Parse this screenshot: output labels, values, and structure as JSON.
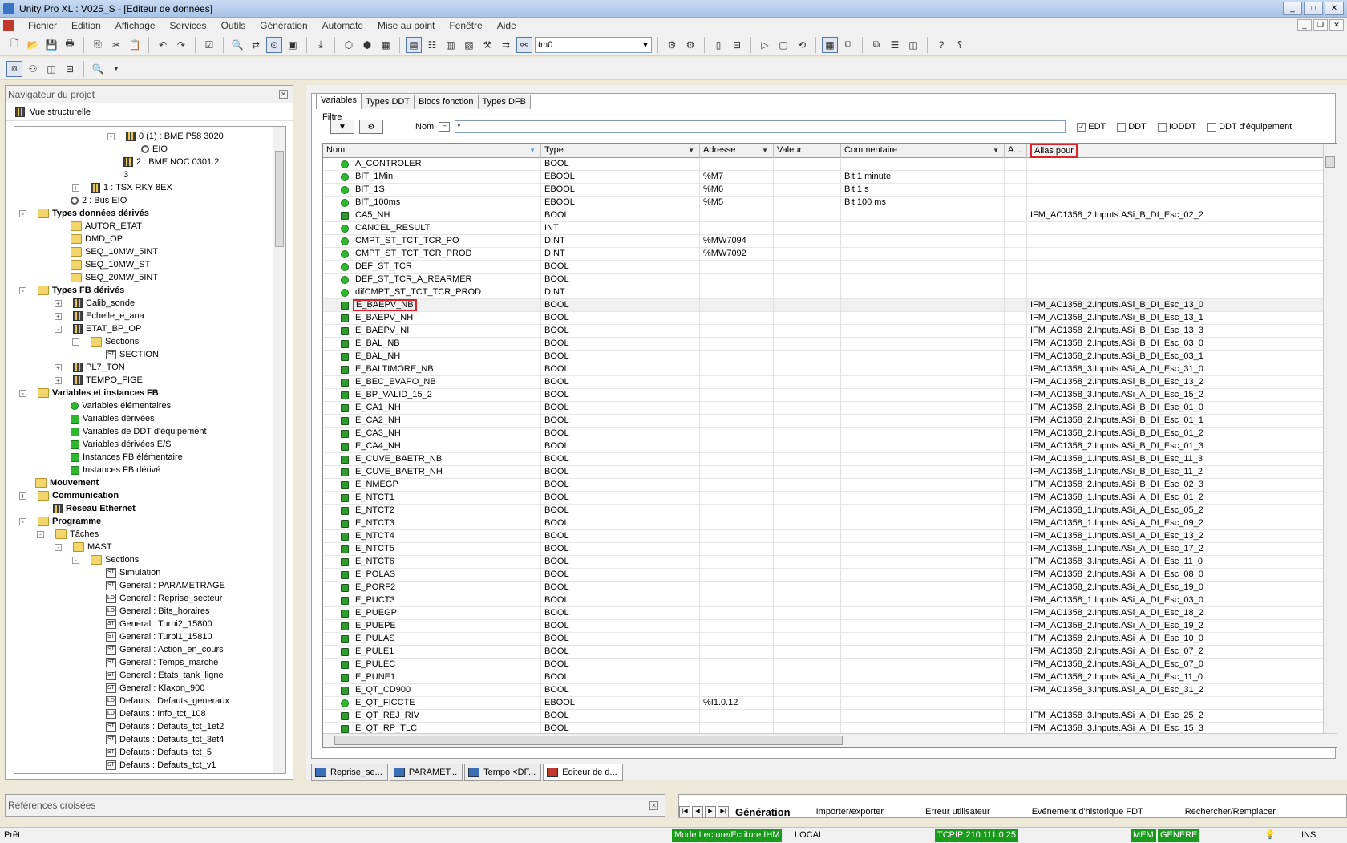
{
  "window": {
    "title": "Unity Pro XL : V025_S - [Editeur de données]"
  },
  "menu": [
    "Fichier",
    "Edition",
    "Affichage",
    "Services",
    "Outils",
    "Génération",
    "Automate",
    "Mise au point",
    "Fenêtre",
    "Aide"
  ],
  "toolbar": {
    "combo_value": "tm0"
  },
  "left_panel": {
    "title": "Navigateur du projet",
    "view_label": "Vue structurelle",
    "tree": [
      {
        "label": "0 (1) : BME P58 3020",
        "indent": 6,
        "icon": "module",
        "exp": "-"
      },
      {
        "label": "EIO",
        "indent": 7,
        "icon": "gear"
      },
      {
        "label": "2 : BME NOC 0301.2",
        "indent": 6,
        "icon": "module"
      },
      {
        "label": "3",
        "indent": 6,
        "icon": "none"
      },
      {
        "label": "1 : TSX RKY 8EX",
        "indent": 4,
        "icon": "module",
        "exp": "+"
      },
      {
        "label": "2 : Bus EIO",
        "indent": 3,
        "icon": "gear"
      },
      {
        "label": "Types données dérivés",
        "indent": 1,
        "icon": "folder",
        "bold": true,
        "exp": "-"
      },
      {
        "label": "AUTOR_ETAT",
        "indent": 3,
        "icon": "folder"
      },
      {
        "label": "DMD_OP",
        "indent": 3,
        "icon": "folder"
      },
      {
        "label": "SEQ_10MW_5INT",
        "indent": 3,
        "icon": "folder"
      },
      {
        "label": "SEQ_10MW_ST",
        "indent": 3,
        "icon": "folder"
      },
      {
        "label": "SEQ_20MW_5INT",
        "indent": 3,
        "icon": "folder"
      },
      {
        "label": "Types FB dérivés",
        "indent": 1,
        "icon": "folder",
        "bold": true,
        "exp": "-"
      },
      {
        "label": "Calib_sonde",
        "indent": 3,
        "icon": "module",
        "exp": "+"
      },
      {
        "label": "Echelle_e_ana",
        "indent": 3,
        "icon": "module",
        "exp": "+"
      },
      {
        "label": "ETAT_BP_OP",
        "indent": 3,
        "icon": "module",
        "exp": "-"
      },
      {
        "label": "Sections",
        "indent": 4,
        "icon": "folder",
        "exp": "-"
      },
      {
        "label": "SECTION",
        "indent": 5,
        "icon": "st"
      },
      {
        "label": "PL7_TON",
        "indent": 3,
        "icon": "module",
        "exp": "+"
      },
      {
        "label": "TEMPO_FIGE",
        "indent": 3,
        "icon": "module",
        "exp": "+"
      },
      {
        "label": "Variables et instances FB",
        "indent": 1,
        "icon": "folder",
        "bold": true,
        "exp": "-"
      },
      {
        "label": "Variables élémentaires",
        "indent": 3,
        "icon": "green"
      },
      {
        "label": "Variables dérivées",
        "indent": 3,
        "icon": "greensq"
      },
      {
        "label": "Variables de DDT d'équipement",
        "indent": 3,
        "icon": "greensq"
      },
      {
        "label": "Variables dérivées E/S",
        "indent": 3,
        "icon": "greensq"
      },
      {
        "label": "Instances FB élémentaire",
        "indent": 3,
        "icon": "greensq"
      },
      {
        "label": "Instances FB dérivé",
        "indent": 3,
        "icon": "greensq"
      },
      {
        "label": "Mouvement",
        "indent": 1,
        "icon": "folder",
        "bold": true
      },
      {
        "label": "Communication",
        "indent": 1,
        "icon": "folder",
        "bold": true,
        "exp": "+"
      },
      {
        "label": "Réseau Ethernet",
        "indent": 2,
        "icon": "module",
        "bold": true
      },
      {
        "label": "Programme",
        "indent": 1,
        "icon": "folder",
        "bold": true,
        "exp": "-"
      },
      {
        "label": "Tâches",
        "indent": 2,
        "icon": "folder",
        "exp": "-"
      },
      {
        "label": "MAST",
        "indent": 3,
        "icon": "folder",
        "exp": "-"
      },
      {
        "label": "Sections",
        "indent": 4,
        "icon": "folder",
        "exp": "-"
      },
      {
        "label": "Simulation",
        "indent": 5,
        "icon": "st"
      },
      {
        "label": "General : PARAMETRAGE",
        "indent": 5,
        "icon": "st"
      },
      {
        "label": "General : Reprise_secteur",
        "indent": 5,
        "icon": "ld"
      },
      {
        "label": "General : Bits_horaires",
        "indent": 5,
        "icon": "ld"
      },
      {
        "label": "General : Turbi2_15800",
        "indent": 5,
        "icon": "st"
      },
      {
        "label": "General : Turbi1_15810",
        "indent": 5,
        "icon": "st"
      },
      {
        "label": "General : Action_en_cours",
        "indent": 5,
        "icon": "st"
      },
      {
        "label": "General : Temps_marche",
        "indent": 5,
        "icon": "st"
      },
      {
        "label": "General : Etats_tank_ligne",
        "indent": 5,
        "icon": "st"
      },
      {
        "label": "General : Klaxon_900",
        "indent": 5,
        "icon": "st"
      },
      {
        "label": "Defauts : Defauts_generaux",
        "indent": 5,
        "icon": "ld"
      },
      {
        "label": "Defauts : Info_tct_108",
        "indent": 5,
        "icon": "ld"
      },
      {
        "label": "Defauts : Defauts_tct_1et2",
        "indent": 5,
        "icon": "st"
      },
      {
        "label": "Defauts : Defauts_tct_3et4",
        "indent": 5,
        "icon": "st"
      },
      {
        "label": "Defauts : Defauts_tct_5",
        "indent": 5,
        "icon": "st"
      },
      {
        "label": "Defauts : Defauts_tct_v1",
        "indent": 5,
        "icon": "st"
      }
    ]
  },
  "editor": {
    "tabs": [
      "Variables",
      "Types DDT",
      "Blocs fonction",
      "Types DFB"
    ],
    "filter_label": "Filtre",
    "name_label": "Nom",
    "eq_label": "=",
    "filter_value": "*",
    "checkboxes": [
      {
        "label": "EDT",
        "checked": true
      },
      {
        "label": "DDT",
        "checked": false
      },
      {
        "label": "IODDT",
        "checked": false
      },
      {
        "label": "DDT d'équipement",
        "checked": false
      }
    ],
    "columns": {
      "nom": "Nom",
      "type": "Type",
      "adresse": "Adresse",
      "valeur": "Valeur",
      "commentaire": "Commentaire",
      "a": "A...",
      "alias": "Alias pour"
    },
    "rows": [
      {
        "icon": "green",
        "name": "A_CONTROLER",
        "type": "BOOL",
        "addr": "",
        "val": "",
        "comment": "",
        "alias": ""
      },
      {
        "icon": "green",
        "name": "BIT_1Min",
        "type": "EBOOL",
        "addr": "%M7",
        "val": "",
        "comment": "Bit  1 minute",
        "alias": ""
      },
      {
        "icon": "green",
        "name": "BIT_1S",
        "type": "EBOOL",
        "addr": "%M6",
        "val": "",
        "comment": "Bit  1 s",
        "alias": ""
      },
      {
        "icon": "green",
        "name": "BIT_100ms",
        "type": "EBOOL",
        "addr": "%M5",
        "val": "",
        "comment": "Bit  100 ms",
        "alias": ""
      },
      {
        "icon": "alias",
        "name": "CA5_NH",
        "type": "BOOL",
        "addr": "",
        "val": "",
        "comment": "",
        "alias": "IFM_AC1358_2.Inputs.ASi_B_DI_Esc_02_2"
      },
      {
        "icon": "green",
        "name": "CANCEL_RESULT",
        "type": "INT",
        "addr": "",
        "val": "",
        "comment": "",
        "alias": ""
      },
      {
        "icon": "green",
        "name": "CMPT_ST_TCT_TCR_PO",
        "type": "DINT",
        "addr": "%MW7094",
        "val": "",
        "comment": "",
        "alias": ""
      },
      {
        "icon": "green",
        "name": "CMPT_ST_TCT_TCR_PROD",
        "type": "DINT",
        "addr": "%MW7092",
        "val": "",
        "comment": "",
        "alias": ""
      },
      {
        "icon": "green",
        "name": "DEF_ST_TCR",
        "type": "BOOL",
        "addr": "",
        "val": "",
        "comment": "",
        "alias": ""
      },
      {
        "icon": "green",
        "name": "DEF_ST_TCR_A_REARMER",
        "type": "BOOL",
        "addr": "",
        "val": "",
        "comment": "",
        "alias": ""
      },
      {
        "icon": "green",
        "name": "difCMPT_ST_TCT_TCR_PROD",
        "type": "DINT",
        "addr": "",
        "val": "",
        "comment": "",
        "alias": ""
      },
      {
        "icon": "alias",
        "name": "E_BAEPV_NB",
        "type": "BOOL",
        "addr": "",
        "val": "",
        "comment": "",
        "alias": "IFM_AC1358_2.Inputs.ASi_B_DI_Esc_13_0",
        "highlight": true
      },
      {
        "icon": "alias",
        "name": "E_BAEPV_NH",
        "type": "BOOL",
        "addr": "",
        "val": "",
        "comment": "",
        "alias": "IFM_AC1358_2.Inputs.ASi_B_DI_Esc_13_1"
      },
      {
        "icon": "alias",
        "name": "E_BAEPV_NI",
        "type": "BOOL",
        "addr": "",
        "val": "",
        "comment": "",
        "alias": "IFM_AC1358_2.Inputs.ASi_B_DI_Esc_13_3"
      },
      {
        "icon": "alias",
        "name": "E_BAL_NB",
        "type": "BOOL",
        "addr": "",
        "val": "",
        "comment": "",
        "alias": "IFM_AC1358_2.Inputs.ASi_B_DI_Esc_03_0"
      },
      {
        "icon": "alias",
        "name": "E_BAL_NH",
        "type": "BOOL",
        "addr": "",
        "val": "",
        "comment": "",
        "alias": "IFM_AC1358_2.Inputs.ASi_B_DI_Esc_03_1"
      },
      {
        "icon": "alias",
        "name": "E_BALTIMORE_NB",
        "type": "BOOL",
        "addr": "",
        "val": "",
        "comment": "",
        "alias": "IFM_AC1358_3.Inputs.ASi_A_DI_Esc_31_0"
      },
      {
        "icon": "alias",
        "name": "E_BEC_EVAPO_NB",
        "type": "BOOL",
        "addr": "",
        "val": "",
        "comment": "",
        "alias": "IFM_AC1358_2.Inputs.ASi_B_DI_Esc_13_2"
      },
      {
        "icon": "alias",
        "name": "E_BP_VALID_15_2",
        "type": "BOOL",
        "addr": "",
        "val": "",
        "comment": "",
        "alias": "IFM_AC1358_3.Inputs.ASi_A_DI_Esc_15_2"
      },
      {
        "icon": "alias",
        "name": "E_CA1_NH",
        "type": "BOOL",
        "addr": "",
        "val": "",
        "comment": "",
        "alias": "IFM_AC1358_2.Inputs.ASi_B_DI_Esc_01_0"
      },
      {
        "icon": "alias",
        "name": "E_CA2_NH",
        "type": "BOOL",
        "addr": "",
        "val": "",
        "comment": "",
        "alias": "IFM_AC1358_2.Inputs.ASi_B_DI_Esc_01_1"
      },
      {
        "icon": "alias",
        "name": "E_CA3_NH",
        "type": "BOOL",
        "addr": "",
        "val": "",
        "comment": "",
        "alias": "IFM_AC1358_2.Inputs.ASi_B_DI_Esc_01_2"
      },
      {
        "icon": "alias",
        "name": "E_CA4_NH",
        "type": "BOOL",
        "addr": "",
        "val": "",
        "comment": "",
        "alias": "IFM_AC1358_2.Inputs.ASi_B_DI_Esc_01_3"
      },
      {
        "icon": "alias",
        "name": "E_CUVE_BAETR_NB",
        "type": "BOOL",
        "addr": "",
        "val": "",
        "comment": "",
        "alias": "IFM_AC1358_1.Inputs.ASi_B_DI_Esc_11_3"
      },
      {
        "icon": "alias",
        "name": "E_CUVE_BAETR_NH",
        "type": "BOOL",
        "addr": "",
        "val": "",
        "comment": "",
        "alias": "IFM_AC1358_1.Inputs.ASi_B_DI_Esc_11_2"
      },
      {
        "icon": "alias",
        "name": "E_NMEGP",
        "type": "BOOL",
        "addr": "",
        "val": "",
        "comment": "",
        "alias": "IFM_AC1358_2.Inputs.ASi_B_DI_Esc_02_3"
      },
      {
        "icon": "alias",
        "name": "E_NTCT1",
        "type": "BOOL",
        "addr": "",
        "val": "",
        "comment": "",
        "alias": "IFM_AC1358_1.Inputs.ASi_A_DI_Esc_01_2"
      },
      {
        "icon": "alias",
        "name": "E_NTCT2",
        "type": "BOOL",
        "addr": "",
        "val": "",
        "comment": "",
        "alias": "IFM_AC1358_1.Inputs.ASi_A_DI_Esc_05_2"
      },
      {
        "icon": "alias",
        "name": "E_NTCT3",
        "type": "BOOL",
        "addr": "",
        "val": "",
        "comment": "",
        "alias": "IFM_AC1358_1.Inputs.ASi_A_DI_Esc_09_2"
      },
      {
        "icon": "alias",
        "name": "E_NTCT4",
        "type": "BOOL",
        "addr": "",
        "val": "",
        "comment": "",
        "alias": "IFM_AC1358_1.Inputs.ASi_A_DI_Esc_13_2"
      },
      {
        "icon": "alias",
        "name": "E_NTCT5",
        "type": "BOOL",
        "addr": "",
        "val": "",
        "comment": "",
        "alias": "IFM_AC1358_1.Inputs.ASi_A_DI_Esc_17_2"
      },
      {
        "icon": "alias",
        "name": "E_NTCT6",
        "type": "BOOL",
        "addr": "",
        "val": "",
        "comment": "",
        "alias": "IFM_AC1358_3.Inputs.ASi_A_DI_Esc_11_0"
      },
      {
        "icon": "alias",
        "name": "E_POLAS",
        "type": "BOOL",
        "addr": "",
        "val": "",
        "comment": "",
        "alias": "IFM_AC1358_2.Inputs.ASi_A_DI_Esc_08_0"
      },
      {
        "icon": "alias",
        "name": "E_PORF2",
        "type": "BOOL",
        "addr": "",
        "val": "",
        "comment": "",
        "alias": "IFM_AC1358_2.Inputs.ASi_A_DI_Esc_19_0"
      },
      {
        "icon": "alias",
        "name": "E_PUCT3",
        "type": "BOOL",
        "addr": "",
        "val": "",
        "comment": "",
        "alias": "IFM_AC1358_1.Inputs.ASi_A_DI_Esc_03_0"
      },
      {
        "icon": "alias",
        "name": "E_PUEGP",
        "type": "BOOL",
        "addr": "",
        "val": "",
        "comment": "",
        "alias": "IFM_AC1358_2.Inputs.ASi_A_DI_Esc_18_2"
      },
      {
        "icon": "alias",
        "name": "E_PUEPE",
        "type": "BOOL",
        "addr": "",
        "val": "",
        "comment": "",
        "alias": "IFM_AC1358_2.Inputs.ASi_A_DI_Esc_19_2"
      },
      {
        "icon": "alias",
        "name": "E_PULAS",
        "type": "BOOL",
        "addr": "",
        "val": "",
        "comment": "",
        "alias": "IFM_AC1358_2.Inputs.ASi_A_DI_Esc_10_0"
      },
      {
        "icon": "alias",
        "name": "E_PULE1",
        "type": "BOOL",
        "addr": "",
        "val": "",
        "comment": "",
        "alias": "IFM_AC1358_2.Inputs.ASi_A_DI_Esc_07_2"
      },
      {
        "icon": "alias",
        "name": "E_PULEC",
        "type": "BOOL",
        "addr": "",
        "val": "",
        "comment": "",
        "alias": "IFM_AC1358_2.Inputs.ASi_A_DI_Esc_07_0"
      },
      {
        "icon": "alias",
        "name": "E_PUNE1",
        "type": "BOOL",
        "addr": "",
        "val": "",
        "comment": "",
        "alias": "IFM_AC1358_2.Inputs.ASi_A_DI_Esc_11_0"
      },
      {
        "icon": "alias",
        "name": "E_QT_CD900",
        "type": "BOOL",
        "addr": "",
        "val": "",
        "comment": "",
        "alias": "IFM_AC1358_3.Inputs.ASi_A_DI_Esc_31_2"
      },
      {
        "icon": "green",
        "name": "E_QT_FICCTE",
        "type": "EBOOL",
        "addr": "%I1.0.12",
        "val": "",
        "comment": "",
        "alias": ""
      },
      {
        "icon": "alias",
        "name": "E_QT_REJ_RIV",
        "type": "BOOL",
        "addr": "",
        "val": "",
        "comment": "",
        "alias": "IFM_AC1358_3.Inputs.ASi_A_DI_Esc_25_2"
      },
      {
        "icon": "alias",
        "name": "E_QT_RP_TLC",
        "type": "BOOL",
        "addr": "",
        "val": "",
        "comment": "",
        "alias": "IFM_AC1358_3.Inputs.ASi_A_DI_Esc_15_3"
      }
    ]
  },
  "doc_tabs": [
    {
      "label": "Reprise_se...",
      "icon": "blue"
    },
    {
      "label": "PARAMET...",
      "icon": "blue"
    },
    {
      "label": "Tempo <DF...",
      "icon": "blue"
    },
    {
      "label": "Editeur de d...",
      "icon": "red",
      "active": true
    }
  ],
  "cross_ref": {
    "title": "Références croisées"
  },
  "output_tabs": [
    "Génération",
    "Importer/exporter",
    "Erreur utilisateur",
    "Evénement d'historique FDT",
    "Rechercher/Remplacer"
  ],
  "status": {
    "ready": "Prêt",
    "mode": "Mode Lecture/Ecriture IHM",
    "local": "LOCAL",
    "tcpip": "TCPIP:210.111.0.25",
    "mem": "MEM",
    "genere": "GENERE",
    "ins": "INS"
  }
}
